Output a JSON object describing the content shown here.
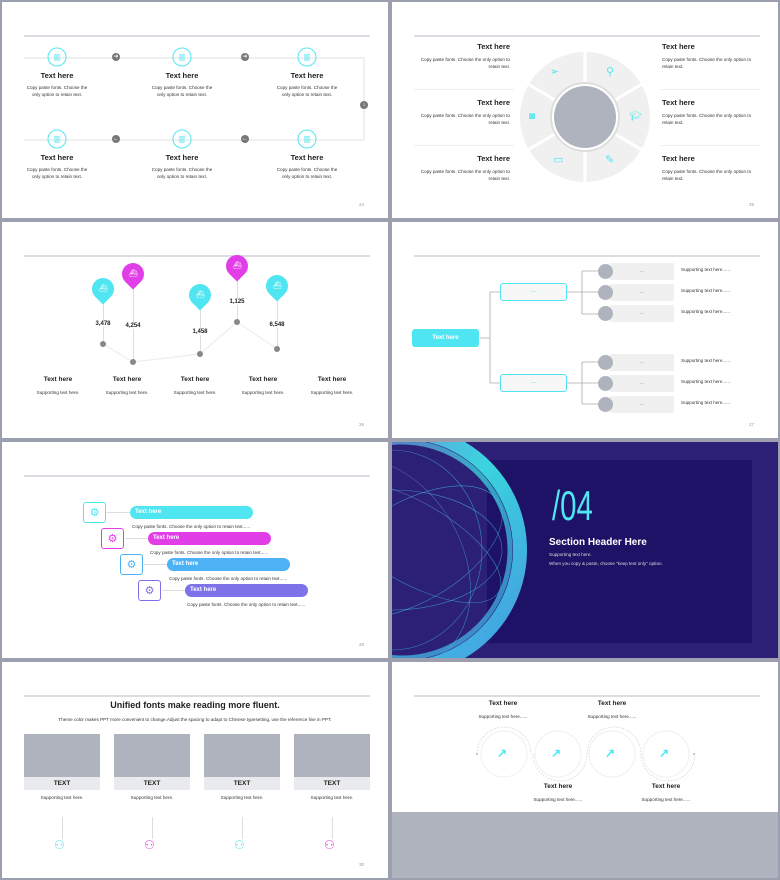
{
  "colors": {
    "cyan": "#4fe6f2",
    "magenta": "#e13ee8",
    "blue": "#4db1f5",
    "purple": "#7d72e8",
    "navy": "#1e1266",
    "gray": "#aeb3bd"
  },
  "slide24": {
    "page": "24",
    "items": [
      {
        "title": "Text here",
        "desc": "Copy paste fonts. Choose the only option to retain text.",
        "icon": "bar-chart-icon"
      },
      {
        "title": "Text here",
        "desc": "Copy paste fonts. Choose the only option to retain text.",
        "icon": "bar-chart-icon"
      },
      {
        "title": "Text here",
        "desc": "Copy paste fonts. Choose the only option to retain text.",
        "icon": "bar-chart-icon"
      },
      {
        "title": "Text here",
        "desc": "Copy paste fonts. Choose the only option to retain text.",
        "icon": "bar-chart-icon"
      },
      {
        "title": "Text here",
        "desc": "Copy paste fonts. Choose the only option to retain text.",
        "icon": "bar-chart-icon"
      },
      {
        "title": "Text here",
        "desc": "Copy paste fonts. Choose the only option to retain text.",
        "icon": "bar-chart-icon"
      }
    ]
  },
  "slide25": {
    "page": "25",
    "items": [
      {
        "title": "Text here",
        "desc": "Copy paste fonts. Choose the only option to retain text."
      },
      {
        "title": "Text here",
        "desc": "Copy paste fonts. Choose the only option to retain text."
      },
      {
        "title": "Text here",
        "desc": "Copy paste fonts. Choose the only option to retain text."
      },
      {
        "title": "Text here",
        "desc": "Copy paste fonts. Choose the only option to retain text."
      },
      {
        "title": "Text here",
        "desc": "Copy paste fonts. Choose the only option to retain text."
      },
      {
        "title": "Text here",
        "desc": "Copy paste fonts. Choose the only option to retain text."
      }
    ],
    "icons": [
      "paper-plane-icon",
      "magnifier-icon",
      "graduation-cap-icon",
      "pencil-icon",
      "monitor-icon",
      "camera-icon"
    ]
  },
  "slide26": {
    "page": "26",
    "values": [
      "3,478",
      "4,254",
      "1,458",
      "1,125",
      "6,548"
    ],
    "items": [
      {
        "title": "Text here",
        "desc": "Supporting text here."
      },
      {
        "title": "Text here",
        "desc": "Supporting text here."
      },
      {
        "title": "Text here",
        "desc": "Supporting text here."
      },
      {
        "title": "Text here",
        "desc": "Supporting text here."
      },
      {
        "title": "Text here",
        "desc": "Supporting text here."
      }
    ]
  },
  "slide27": {
    "page": "27",
    "root": "Text here",
    "branch": "—",
    "leaf": "...",
    "support": "Supporting text here......"
  },
  "slide28": {
    "page": "28",
    "items": [
      {
        "title": "Text here",
        "desc": "Copy paste fonts. Choose the only option to retain text......"
      },
      {
        "title": "Text here",
        "desc": "Copy paste fonts. Choose the only option to retain text......"
      },
      {
        "title": "Text here",
        "desc": "Copy paste fonts. Choose the only option to retain text......"
      },
      {
        "title": "Text here",
        "desc": "Copy paste fonts. Choose the only option to retain text......"
      }
    ]
  },
  "slide29": {
    "number": "/04",
    "header": "Section Header Here",
    "support": "Supporting text here.",
    "note": "When you copy & paste, choose \"keep text only\" option."
  },
  "slide30": {
    "page": "30",
    "title": "Unified fonts make reading more fluent.",
    "subtitle": "Theme color makes PPT more convenient to change.Adjust the spacing to adapt to Chinese typesetting, use the reference line in PPT.",
    "cards": [
      {
        "label": "TEXT",
        "desc": "Supporting text here."
      },
      {
        "label": "TEXT",
        "desc": "Supporting text here."
      },
      {
        "label": "TEXT",
        "desc": "Supporting text here."
      },
      {
        "label": "TEXT",
        "desc": "Supporting text here."
      }
    ]
  },
  "slide31": {
    "items": [
      {
        "title": "Text here",
        "desc": "Supporting text here......"
      },
      {
        "title": "Text here",
        "desc": "Supporting text here......"
      },
      {
        "title": "Text here",
        "desc": "Supporting text here......"
      },
      {
        "title": "Text here",
        "desc": "Supporting text here......"
      }
    ]
  }
}
